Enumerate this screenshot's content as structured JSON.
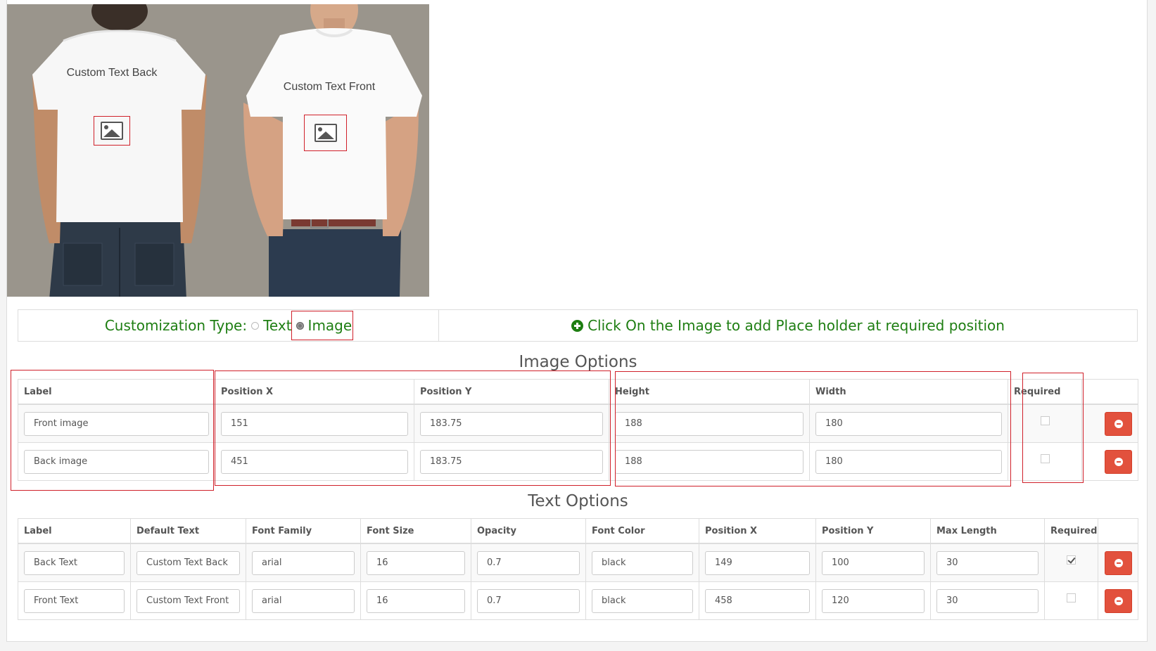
{
  "preview": {
    "back_text": "Custom Text Back",
    "front_text": "Custom Text Front",
    "placeholder_icon": "image-icon",
    "background_color": "#9a958c"
  },
  "customization": {
    "label": "Customization Type:",
    "options": [
      {
        "label": "Text",
        "selected": false
      },
      {
        "label": "Image",
        "selected": true
      }
    ],
    "hint_icon": "plus-circle-icon",
    "hint": "Click On the Image to add Place holder at required position",
    "accent_color": "#1e7e12"
  },
  "image_options": {
    "title": "Image Options",
    "columns": [
      "Label",
      "Position X",
      "Position Y",
      "Height",
      "Width",
      "Required",
      ""
    ],
    "rows": [
      {
        "label": "Front image",
        "position_x": "151",
        "position_y": "183.75",
        "height": "188",
        "width": "180",
        "required": false
      },
      {
        "label": "Back image",
        "position_x": "451",
        "position_y": "183.75",
        "height": "188",
        "width": "180",
        "required": false
      }
    ]
  },
  "text_options": {
    "title": "Text Options",
    "columns": [
      "Label",
      "Default Text",
      "Font Family",
      "Font Size",
      "Opacity",
      "Font Color",
      "Position X",
      "Position Y",
      "Max Length",
      "Required",
      ""
    ],
    "rows": [
      {
        "label": "Back Text",
        "default_text": "Custom Text Back",
        "font_family": "arial",
        "font_size": "16",
        "opacity": "0.7",
        "font_color": "black",
        "position_x": "149",
        "position_y": "100",
        "max_length": "30",
        "required": true
      },
      {
        "label": "Front Text",
        "default_text": "Custom Text Front",
        "font_family": "arial",
        "font_size": "16",
        "opacity": "0.7",
        "font_color": "black",
        "position_x": "458",
        "position_y": "120",
        "max_length": "30",
        "required": false
      }
    ]
  },
  "remove_button_icon": "minus-circle-icon",
  "remove_button_color": "#e2513d"
}
